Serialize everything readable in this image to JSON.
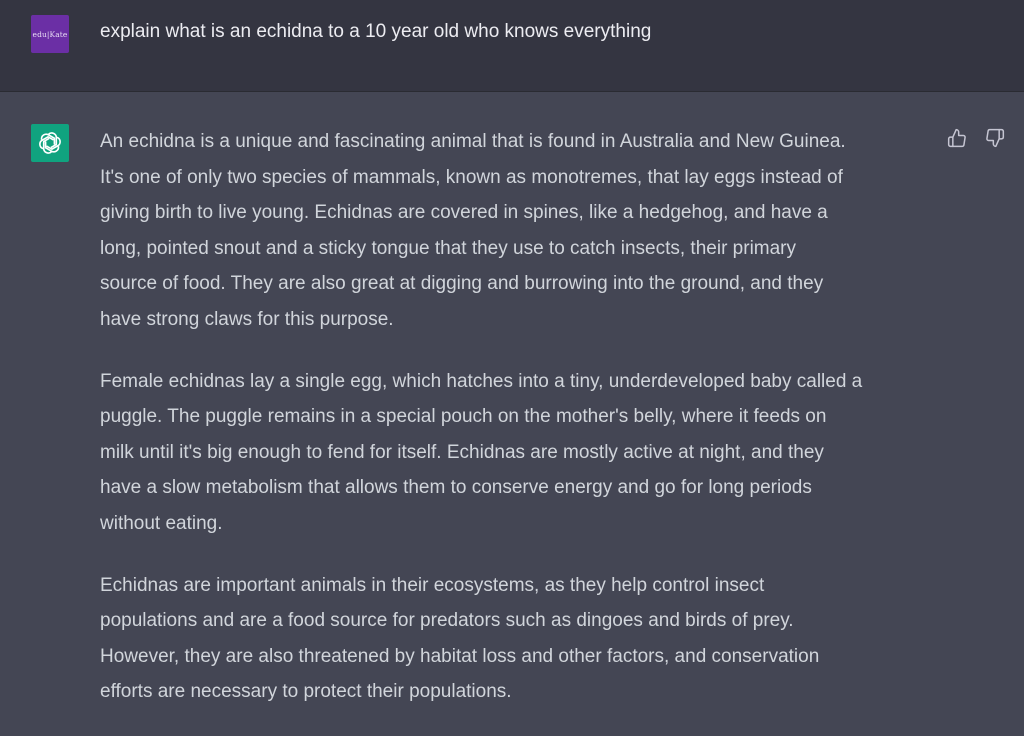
{
  "user": {
    "avatar_text": "edu|Kate",
    "message": "explain what is an echidna to a 10 year old who knows everything"
  },
  "assistant": {
    "avatar_icon": "openai-logo-icon",
    "paragraphs": [
      "An echidna is a unique and fascinating animal that is found in Australia and New Guinea.\nIt's one of only two species of mammals, known as monotremes, that lay eggs instead of\ngiving birth to live young. Echidnas are covered in spines, like a hedgehog, and have a\nlong, pointed snout and a sticky tongue that they use to catch insects, their primary\nsource of food. They are also great at digging and burrowing into the ground, and they\nhave strong claws for this purpose.",
      "Female echidnas lay a single egg, which hatches into a tiny, underdeveloped baby called a\npuggle. The puggle remains in a special pouch on the mother's belly, where it feeds on\nmilk until it's big enough to fend for itself. Echidnas are mostly active at night, and they\nhave a slow metabolism that allows them to conserve energy and go for long periods\nwithout eating.",
      "Echidnas are important animals in their ecosystems, as they help control insect\npopulations and are a food source for predators such as dingoes and birds of prey.\nHowever, they are also threatened by habitat loss and other factors, and conservation\nefforts are necessary to protect their populations."
    ]
  },
  "feedback": {
    "thumbs_up_icon": "thumbs-up-icon",
    "thumbs_down_icon": "thumbs-down-icon"
  },
  "colors": {
    "user_bg": "#343541",
    "assistant_bg": "#444654",
    "user_avatar_bg": "#6b2fa5",
    "assistant_avatar_bg": "#10a37f",
    "text": "#d1d5db"
  }
}
